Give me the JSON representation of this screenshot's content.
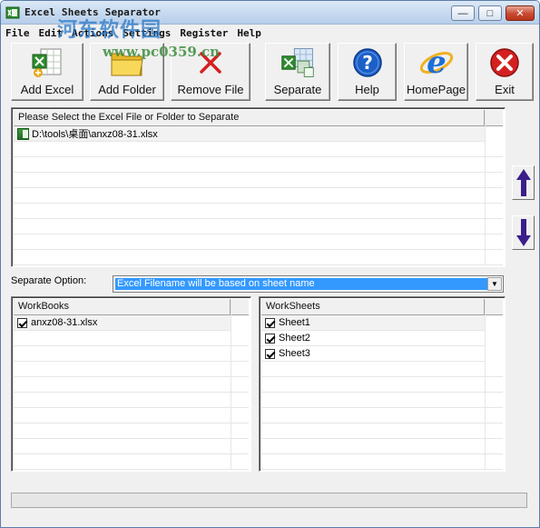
{
  "window": {
    "title": "Excel Sheets Separator",
    "minimize_glyph": "—",
    "maximize_glyph": "□",
    "close_glyph": "✕"
  },
  "watermark": {
    "text": "河东软件园",
    "url": "www.pc0359.cn"
  },
  "menu": [
    "File",
    "Edit",
    "Actions",
    "Settings",
    "Register",
    "Help"
  ],
  "toolbar": {
    "add_excel": "Add Excel",
    "add_folder": "Add Folder",
    "remove_file": "Remove File",
    "separate": "Separate",
    "help": "Help",
    "homepage": "HomePage",
    "exit": "Exit"
  },
  "file_list": {
    "header": "Please Select the Excel File or Folder to Separate",
    "items": [
      "D:\\tools\\桌面\\anxz08-31.xlsx"
    ]
  },
  "separate_option": {
    "label": "Separate Option:",
    "selected": "Excel Filename will be based on sheet name"
  },
  "workbooks": {
    "header": "WorkBooks",
    "items": [
      "anxz08-31.xlsx"
    ]
  },
  "worksheets": {
    "header": "WorkSheets",
    "items": [
      "Sheet1",
      "Sheet2",
      "Sheet3"
    ]
  },
  "colors": {
    "selection": "#3399ff",
    "arrow": "#3a1f8a",
    "exit_red": "#d42020",
    "help_blue": "#1c5fc7"
  }
}
